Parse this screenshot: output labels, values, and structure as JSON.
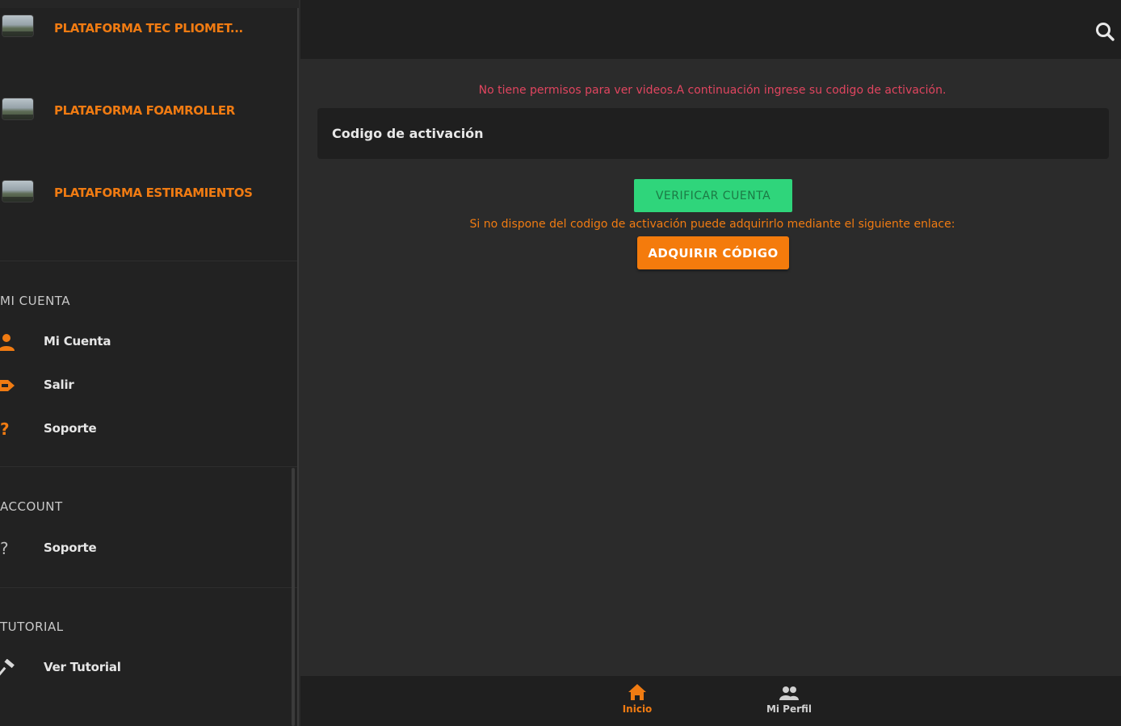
{
  "sidebar": {
    "platforms": [
      {
        "label": "PLATAFORMA TEC PLIOMET..."
      },
      {
        "label": "PLATAFORMA FOAMROLLER"
      },
      {
        "label": "PLATAFORMA ESTIRAMIENTOS"
      }
    ],
    "sections": {
      "mi_cuenta": {
        "title": "MI CUENTA",
        "items": [
          {
            "label": "Mi Cuenta",
            "icon": "person-icon"
          },
          {
            "label": "Salir",
            "icon": "exit-icon"
          },
          {
            "label": "Soporte",
            "icon": "help-icon"
          }
        ]
      },
      "account": {
        "title": "ACCOUNT",
        "items": [
          {
            "label": "Soporte",
            "icon": "help-icon"
          }
        ]
      },
      "tutorial": {
        "title": "TUTORIAL",
        "items": [
          {
            "label": "Ver Tutorial",
            "icon": "hammer-icon"
          }
        ]
      }
    }
  },
  "main": {
    "notice": "No tiene permisos para ver videos.A continuación ingrese su codigo de activación.",
    "code_placeholder": "Codigo de activación",
    "verify_label": "VERIFICAR CUENTA",
    "hint": "Si no dispone del codigo de activación puede adquirirlo mediante el siguiente enlace:",
    "acquire_label": "ADQUIRIR CÓDIGO"
  },
  "bottom_nav": {
    "tabs": [
      {
        "label": "Inicio",
        "icon": "home-icon",
        "active": true
      },
      {
        "label": "Mi Perfil",
        "icon": "people-icon",
        "active": false
      }
    ]
  },
  "colors": {
    "accent": "#f07b12",
    "notice": "#e0455f",
    "verify": "#2fd57b"
  }
}
